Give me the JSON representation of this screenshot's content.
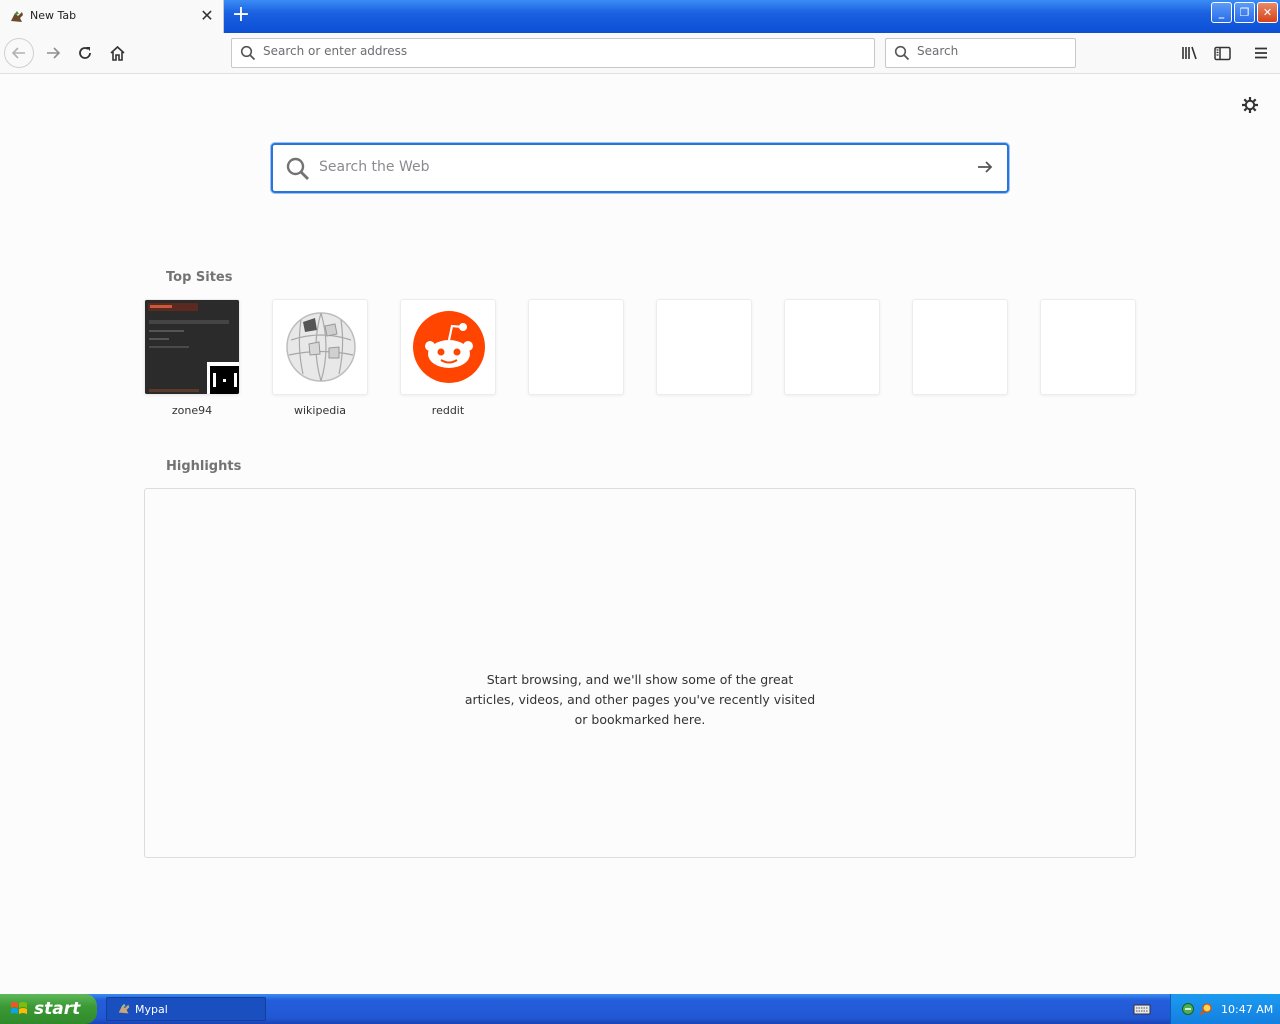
{
  "tab": {
    "title": "New Tab",
    "close": "✕",
    "new_tab": "+"
  },
  "window_controls": {
    "minimize": "_",
    "maximize": "❐",
    "close": "✕"
  },
  "toolbar": {
    "url_placeholder": "Search or enter address",
    "search_placeholder": "Search"
  },
  "main": {
    "web_search_placeholder": "Search the Web",
    "top_sites_title": "Top Sites",
    "top_sites": [
      {
        "label": "zone94"
      },
      {
        "label": "wikipedia"
      },
      {
        "label": "reddit"
      },
      {
        "label": ""
      },
      {
        "label": ""
      },
      {
        "label": ""
      },
      {
        "label": ""
      },
      {
        "label": ""
      }
    ],
    "highlights_title": "Highlights",
    "highlights_message": "Start browsing, and we'll show some of the great articles, videos, and other pages you've recently visited or bookmarked here."
  },
  "taskbar": {
    "start_label": "start",
    "task_label": "Mypal",
    "clock": "10:47 AM"
  },
  "colors": {
    "accent": "#2a76d8",
    "reddit": "#ff4500",
    "taskbar": "#245edb",
    "start_green": "#3c9a36"
  }
}
